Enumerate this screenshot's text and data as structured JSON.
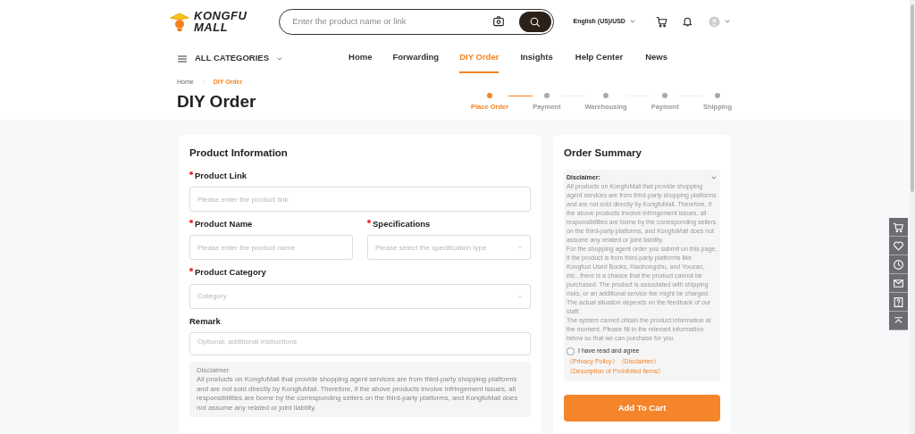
{
  "header": {
    "logo_top": "KONGFU",
    "logo_bottom": "MALL",
    "search": {
      "placeholder": "Enter the product name or link"
    },
    "language": "English (US)/USD"
  },
  "nav": {
    "categories": "ALL CATEGORIES",
    "items": [
      {
        "label": "Home",
        "selected": false
      },
      {
        "label": "Forwarding",
        "selected": false
      },
      {
        "label": "DIY Order",
        "selected": true
      },
      {
        "label": "Insights",
        "selected": false
      },
      {
        "label": "Help Center",
        "selected": false
      },
      {
        "label": "News",
        "selected": false
      }
    ]
  },
  "breadcrumb": [
    {
      "label": "Home",
      "selected": false
    },
    {
      "label": "DIY Order",
      "selected": true
    }
  ],
  "page_title": "DIY Order",
  "steps": [
    {
      "label": "Place Order",
      "selected": true
    },
    {
      "label": "Payment",
      "selected": false
    },
    {
      "label": "Warehousing",
      "selected": false
    },
    {
      "label": "Payment",
      "selected": false
    },
    {
      "label": "Shipping",
      "selected": false
    }
  ],
  "product_info": {
    "title": "Product Information",
    "rows": [
      [
        {
          "label": "Product Link",
          "required": true,
          "kind": "input",
          "placeholder": "Please enter the product link"
        }
      ],
      [
        {
          "label": "Product Name",
          "required": true,
          "kind": "input",
          "placeholder": "Please enter the product name"
        },
        {
          "label": "Specifications",
          "required": true,
          "kind": "select",
          "placeholder": "Please select the specification type"
        }
      ],
      [
        {
          "label": "Product Category",
          "required": true,
          "kind": "select",
          "placeholder": "Category"
        }
      ],
      [
        {
          "label": "Remark",
          "required": false,
          "kind": "textarea",
          "placeholder": "Optional, additional instructions"
        }
      ]
    ],
    "disclaimer_title": "Disclaimer",
    "disclaimer_text": "All products on KongfuMall that provide shopping agent services are from third-party shopping platforms and are not sold directly by KongfuMall. Therefore, if the above products involve infringement issues, all responsibilities are borne by the corresponding sellers on the third-party platforms, and KongfuMall does not assume any related or joint liability."
  },
  "order_summary": {
    "title": "Order Summary",
    "disclaimer_title": "Disclaimer:",
    "expanded": true,
    "paragraphs": [
      "All products on KongfuMall that provide shopping agent services are from third-party shopping platforms and are not sold directly by KongfuMall. Therefore, if the above products involve infringement issues, all responsibilities are borne by the corresponding sellers on the third-party platforms, and KongfuMall does not assume any related or joint liability.",
      "For the shopping agent order you submit on this page, if the product is from third-party platforms like Kongfuzi Used Books, Xiaohongshu, and Youzan, etc., there is a chance that the product cannot be purchased. The product is associated with shipping risks, or an additional service fee might be charged. The actual situation depends on the feedback of our staff.",
      "The system cannot obtain the product information at the moment. Please fill in the relevant information below so that we can purchase for you."
    ],
    "agree": {
      "label": "I have read and agree",
      "checked": false,
      "links": [
        "《Privacy Policy》",
        "《Disclaimer》",
        "《Description of Prohibited Items》"
      ]
    },
    "button": "Add To Cart"
  }
}
